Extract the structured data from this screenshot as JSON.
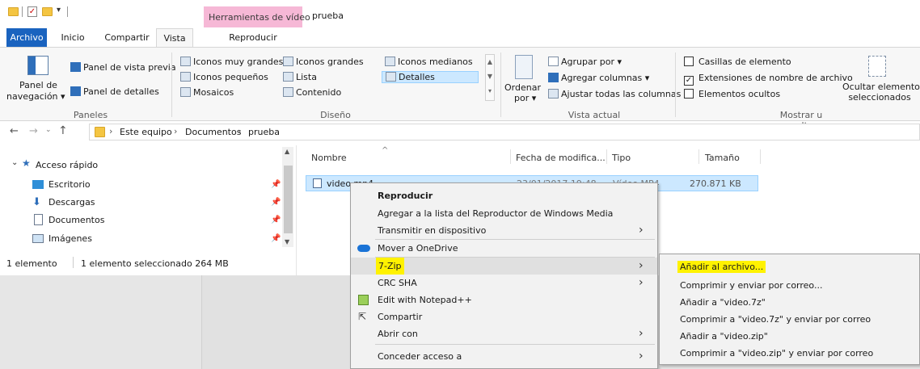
{
  "window": {
    "title": "prueba",
    "contextual_tab": "Herramientas de vídeo"
  },
  "tabs": {
    "archivo": "Archivo",
    "inicio": "Inicio",
    "compartir": "Compartir",
    "vista": "Vista",
    "reproducir": "Reproducir"
  },
  "ribbon": {
    "panel_navegacion_1": "Panel de",
    "panel_navegacion_2": "navegación",
    "panel_vista_previa": "Panel de vista previa",
    "panel_detalles": "Panel de detalles",
    "paneles_group": "Paneles",
    "iconos_muy_grandes": "Iconos muy grandes",
    "iconos_grandes": "Iconos grandes",
    "iconos_medianos": "Iconos medianos",
    "iconos_pequenos": "Iconos pequeños",
    "lista": "Lista",
    "detalles": "Detalles",
    "mosaicos": "Mosaicos",
    "contenido": "Contenido",
    "diseno_group": "Diseño",
    "ordenar_1": "Ordenar",
    "ordenar_2": "por",
    "agrupar_por": "Agrupar por",
    "agregar_columnas": "Agregar columnas",
    "ajustar_columnas": "Ajustar todas las columnas",
    "vista_actual_group": "Vista actual",
    "casillas": "Casillas de elemento",
    "extensiones": "Extensiones de nombre de archivo",
    "ocultos": "Elementos ocultos",
    "ocultar_1": "Ocultar elementos",
    "ocultar_2": "seleccionados",
    "mostrar_group": "Mostrar u ocultar"
  },
  "address": {
    "crumb1": "Este equipo",
    "crumb2": "Documentos",
    "crumb3": "prueba"
  },
  "nav": {
    "acceso_rapido": "Acceso rápido",
    "escritorio": "Escritorio",
    "descargas": "Descargas",
    "documentos": "Documentos",
    "imagenes": "Imágenes"
  },
  "status": {
    "count": "1 elemento",
    "selected": "1 elemento seleccionado  264 MB"
  },
  "columns": {
    "nombre": "Nombre",
    "fecha": "Fecha de modifica...",
    "tipo": "Tipo",
    "tamano": "Tamaño"
  },
  "file": {
    "name": "video.mp4",
    "date": "23/01/2017 19:48",
    "type": "Vídeo MP4",
    "size": "270.871 KB"
  },
  "context_menu": {
    "reproducir": "Reproducir",
    "agregar_lista": "Agregar a la lista del Reproductor de Windows Media",
    "transmitir": "Transmitir en dispositivo",
    "onedrive": "Mover a OneDrive",
    "zip": "7-Zip",
    "crc": "CRC SHA",
    "notepad": "Edit with Notepad++",
    "compartir": "Compartir",
    "abrir_con": "Abrir con",
    "conceder": "Conceder acceso a"
  },
  "submenu": {
    "anadir_archivo": "Añadir al archivo...",
    "comprimir_correo": "Comprimir y enviar por correo...",
    "anadir_7z": "Añadir a \"video.7z\"",
    "comprimir_7z": "Comprimir a \"video.7z\" y enviar por correo",
    "anadir_zip": "Añadir a \"video.zip\"",
    "comprimir_zip": "Comprimir a \"video.zip\" y enviar por correo"
  },
  "colors": {
    "accent": "#1a63bf",
    "selection": "#cce8ff",
    "context_tab": "#f6b8d6",
    "highlight": "#fff200"
  }
}
